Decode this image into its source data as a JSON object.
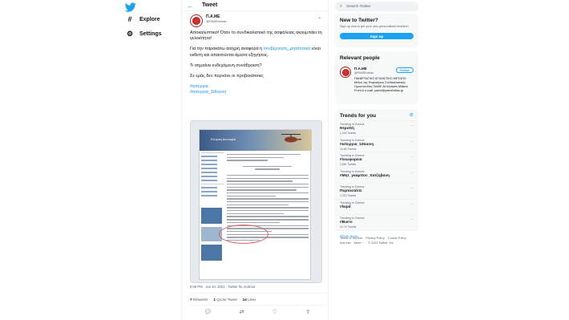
{
  "nav": {
    "logo": "twitter-bird",
    "explore": "Explore",
    "settings": "Settings"
  },
  "header": {
    "title": "Tweet"
  },
  "tweet": {
    "author_name": "Π.Α.ΜΕ",
    "author_handle": "@PAMEhellas",
    "p1": "Αποκαλυπτικό! Όταν το συνδικαλιστικό της ασφάλειας ακουμπάει τη γελοιότητα!",
    "p2_a": "Για την παρακάτω αισχρή αναφορά η ",
    "p2_tag": "#κυβέρνηση_μητσοτακη",
    "p2_b": " είναι εκθετη και απαιτούνται άμεσα εξηγήσεις.",
    "p3": "Τι σημαίνει ενδεχόμενη συνάθροιση?",
    "p4": "Σε εμάς δεν περνάνε οι προβοκάτσιες",
    "tag1": "#απεργια",
    "tag2": "#απεργια_10Ιουνη",
    "media_banner": "Ελληνική Αστυνομία",
    "meta": "5:08 PM · Jun 10, 2021 · Twitter for Android",
    "retweets_count": "7",
    "retweets_label": "Retweets",
    "quotes_count": "1",
    "quotes_label": "Quote Tweet",
    "likes_count": "14",
    "likes_label": "Likes"
  },
  "search": {
    "placeholder": "Search Twitter"
  },
  "new_to_twitter": {
    "title": "New to Twitter?",
    "subtitle": "Sign up now to get your own personalized timeline!",
    "signup": "Sign up"
  },
  "relevant": {
    "title": "Relevant people",
    "name": "Π.Α.ΜΕ",
    "handle": "@PAMEhellas",
    "follow": "Follow",
    "bio": "ΠΑΝΕΡΓΑΤΙΚΟ ΑΓΩΝΙΣΤΙΚΟ ΜΕΤΩΠΟ Μέλος της Παγκόσμιας Συνδικαλιστικής Ομοσπονδίας ΠΑΜΕ All Workers Militant Front & e-mail: pame@pamehellas.gr"
  },
  "trends": {
    "title": "Trends for you",
    "items": [
      {
        "context": "Trending in Greece",
        "name": "Ντροπή",
        "count": "1,249 Tweets"
      },
      {
        "context": "Trending in Greece",
        "name": "#απεργια_10Ιουνη",
        "count": "16.6K Tweets"
      },
      {
        "context": "Trending in Greece",
        "name": "#λεωφορεια",
        "count": "2,081 Tweets"
      },
      {
        "context": "Trending in Greece",
        "name": "#Μητ_γκαμπον_Χατζηβανη",
        "count": ""
      },
      {
        "context": "Trending in Greece",
        "name": "Πορτοσάλτε",
        "count": "1,220 Tweets"
      },
      {
        "context": "Trending in Greece",
        "name": "#lwpd",
        "count": ""
      },
      {
        "context": "Trending in Greece",
        "name": "#Burro",
        "count": "12.7K Tweets"
      }
    ],
    "show_more": "Show more"
  },
  "footer": {
    "line1": [
      "Terms of Service",
      "Privacy Policy",
      "Cookie Policy"
    ],
    "line2": [
      "Ads info",
      "More ···",
      "© 2021 Twitter, Inc."
    ]
  },
  "colors": {
    "accent": "#1da1f2",
    "text": "#0f1419",
    "muted": "#536471",
    "annotation": "#e06060"
  }
}
